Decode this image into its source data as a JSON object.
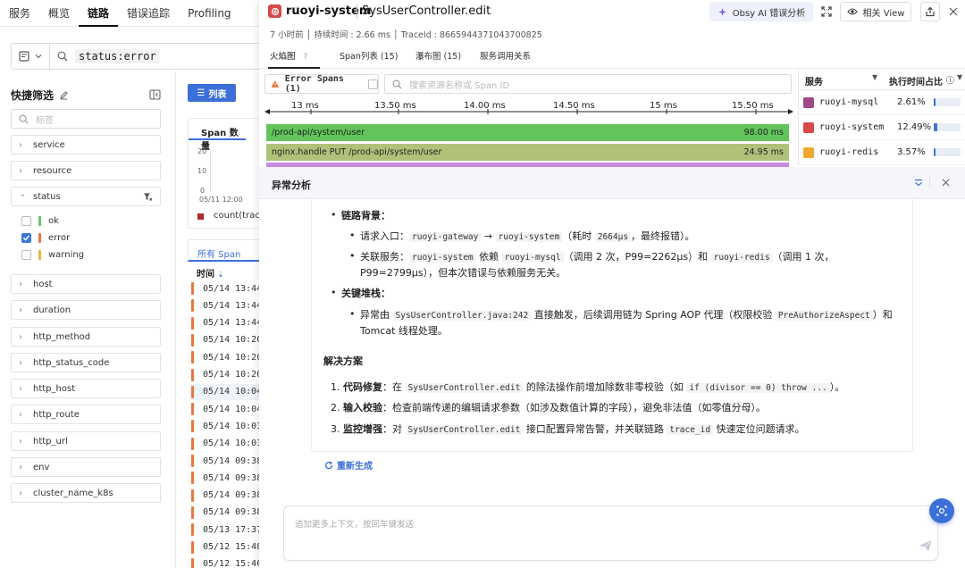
{
  "nav": {
    "items": [
      "服务",
      "概览",
      "链路",
      "错误追踪",
      "Profiling"
    ],
    "active": "链路"
  },
  "search": {
    "query": "status:error"
  },
  "quick_filter": {
    "title": "快捷筛选",
    "tag_placeholder": "标签",
    "facets": [
      "service",
      "resource",
      "status",
      "host",
      "duration",
      "http_method",
      "http_status_code",
      "http_host",
      "http_route",
      "http_url",
      "env",
      "cluster_name_k8s"
    ],
    "status_options": [
      {
        "label": "ok",
        "checked": false,
        "color": "#6cc36c"
      },
      {
        "label": "error",
        "checked": true,
        "color": "#e8783c"
      },
      {
        "label": "warning",
        "checked": false,
        "color": "#f0b040"
      }
    ]
  },
  "middle": {
    "list_button": "列表",
    "span_count_tab": "Span 数量",
    "y_ticks": [
      "20",
      "10",
      "0"
    ],
    "x_tick": "05/11 12:00",
    "legend": "count(trace",
    "all_span_tab": "所有 Span",
    "time_header": "时间",
    "rows": [
      "05/14 13:44",
      "05/14 13:44",
      "05/14 13:44",
      "05/14 10:20",
      "05/14 10:20",
      "05/14 10:20",
      "05/14 10:04",
      "05/14 10:04",
      "05/14 10:03",
      "05/14 10:03",
      "05/14 09:38",
      "05/14 09:38",
      "05/14 09:38",
      "05/14 09:38",
      "05/13 17:37",
      "05/12 15:48",
      "05/12 15:46"
    ],
    "highlighted_row": 6
  },
  "panel": {
    "service": "ruoyi-system",
    "operation": "SysUserController.edit",
    "ai_button": "Obsy AI 错误分析",
    "view_button": "相关 View",
    "meta": "7 小时前 │ 持续时间 : 2.66 ms │ TraceId : 8665944371043700825",
    "tabs": [
      "火焰图",
      "Span列表 (15)",
      "瀑布图 (15)",
      "服务调用关系"
    ],
    "error_spans": "Error Spans (1)",
    "span_search_placeholder": "搜索资源名称或 Span ID",
    "ticks": [
      "13 ms",
      "13.50 ms",
      "14.00 ms",
      "14.50 ms",
      "15 ms",
      "15.50 ms"
    ],
    "flame": [
      {
        "label": "/prod-api/system/user",
        "duration": "98.00 ms",
        "color": "#62c55a"
      },
      {
        "label": "nginx.handle PUT /prod-api/system/user",
        "duration": "24.95 ms",
        "color": "#b0c27a"
      }
    ],
    "service_col": "服务",
    "time_col": "执行时间占比",
    "services": [
      {
        "name": "ruoyi-mysql",
        "pct": "2.61%",
        "frac": 0.0261,
        "color": "#a04a88"
      },
      {
        "name": "ruoyi-system",
        "pct": "12.49%",
        "frac": 0.1249,
        "color": "#d94848"
      },
      {
        "name": "ruoyi-redis",
        "pct": "3.57%",
        "frac": 0.0357,
        "color": "#f0a830"
      }
    ]
  },
  "analysis": {
    "title": "异常分析",
    "s1": "链路背景：",
    "s1a_pre": "请求入口：",
    "s1a_c1": "ruoyi-gateway",
    "s1a_arrow": " → ",
    "s1a_c2": "ruoyi-system",
    "s1a_mid": "（耗时 ",
    "s1a_c3": "2664μs",
    "s1a_post": "，最终报错）。",
    "s1b_pre": "关联服务：",
    "s1b_c1": "ruoyi-system",
    "s1b_m1": " 依赖 ",
    "s1b_c2": "ruoyi-mysql",
    "s1b_m2": "（调用 2 次，P99=2262μs）和 ",
    "s1b_c3": "ruoyi-redis",
    "s1b_m3": "（调用 1 次，",
    "s1b_line2": "P99=2799μs），但本次错误与依赖服务无关。",
    "s2": "关键堆栈：",
    "s2a_pre": "异常由 ",
    "s2a_c1": "SysUserController.java:242",
    "s2a_m1": " 直接触发，后续调用链为 Spring AOP 代理（权限校验 ",
    "s2a_c2": "PreAuthorizeAspect",
    "s2a_m2": "）和",
    "s2a_line2": "Tomcat 线程处理。",
    "solution_title": "解决方案",
    "f1_label": "代码修复",
    "f1_pre": "：在 ",
    "f1_c1": "SysUserController.edit",
    "f1_mid": " 的除法操作前增加除数非零校验（如 ",
    "f1_c2": "if (divisor == 0) throw ...",
    "f1_post": "）。",
    "f2_label": "输入校验",
    "f2_text": "：检查前端传递的编辑请求参数（如涉及数值计算的字段），避免非法值（如零值分母）。",
    "f3_label": "监控增强",
    "f3_pre": "：对 ",
    "f3_c1": "SysUserController.edit",
    "f3_mid": " 接口配置异常告警，并关联链路 ",
    "f3_c2": "trace_id",
    "f3_post": " 快速定位问题请求。",
    "regen": "重新生成",
    "chat_placeholder": "追加更多上下文，按回车键发送"
  }
}
